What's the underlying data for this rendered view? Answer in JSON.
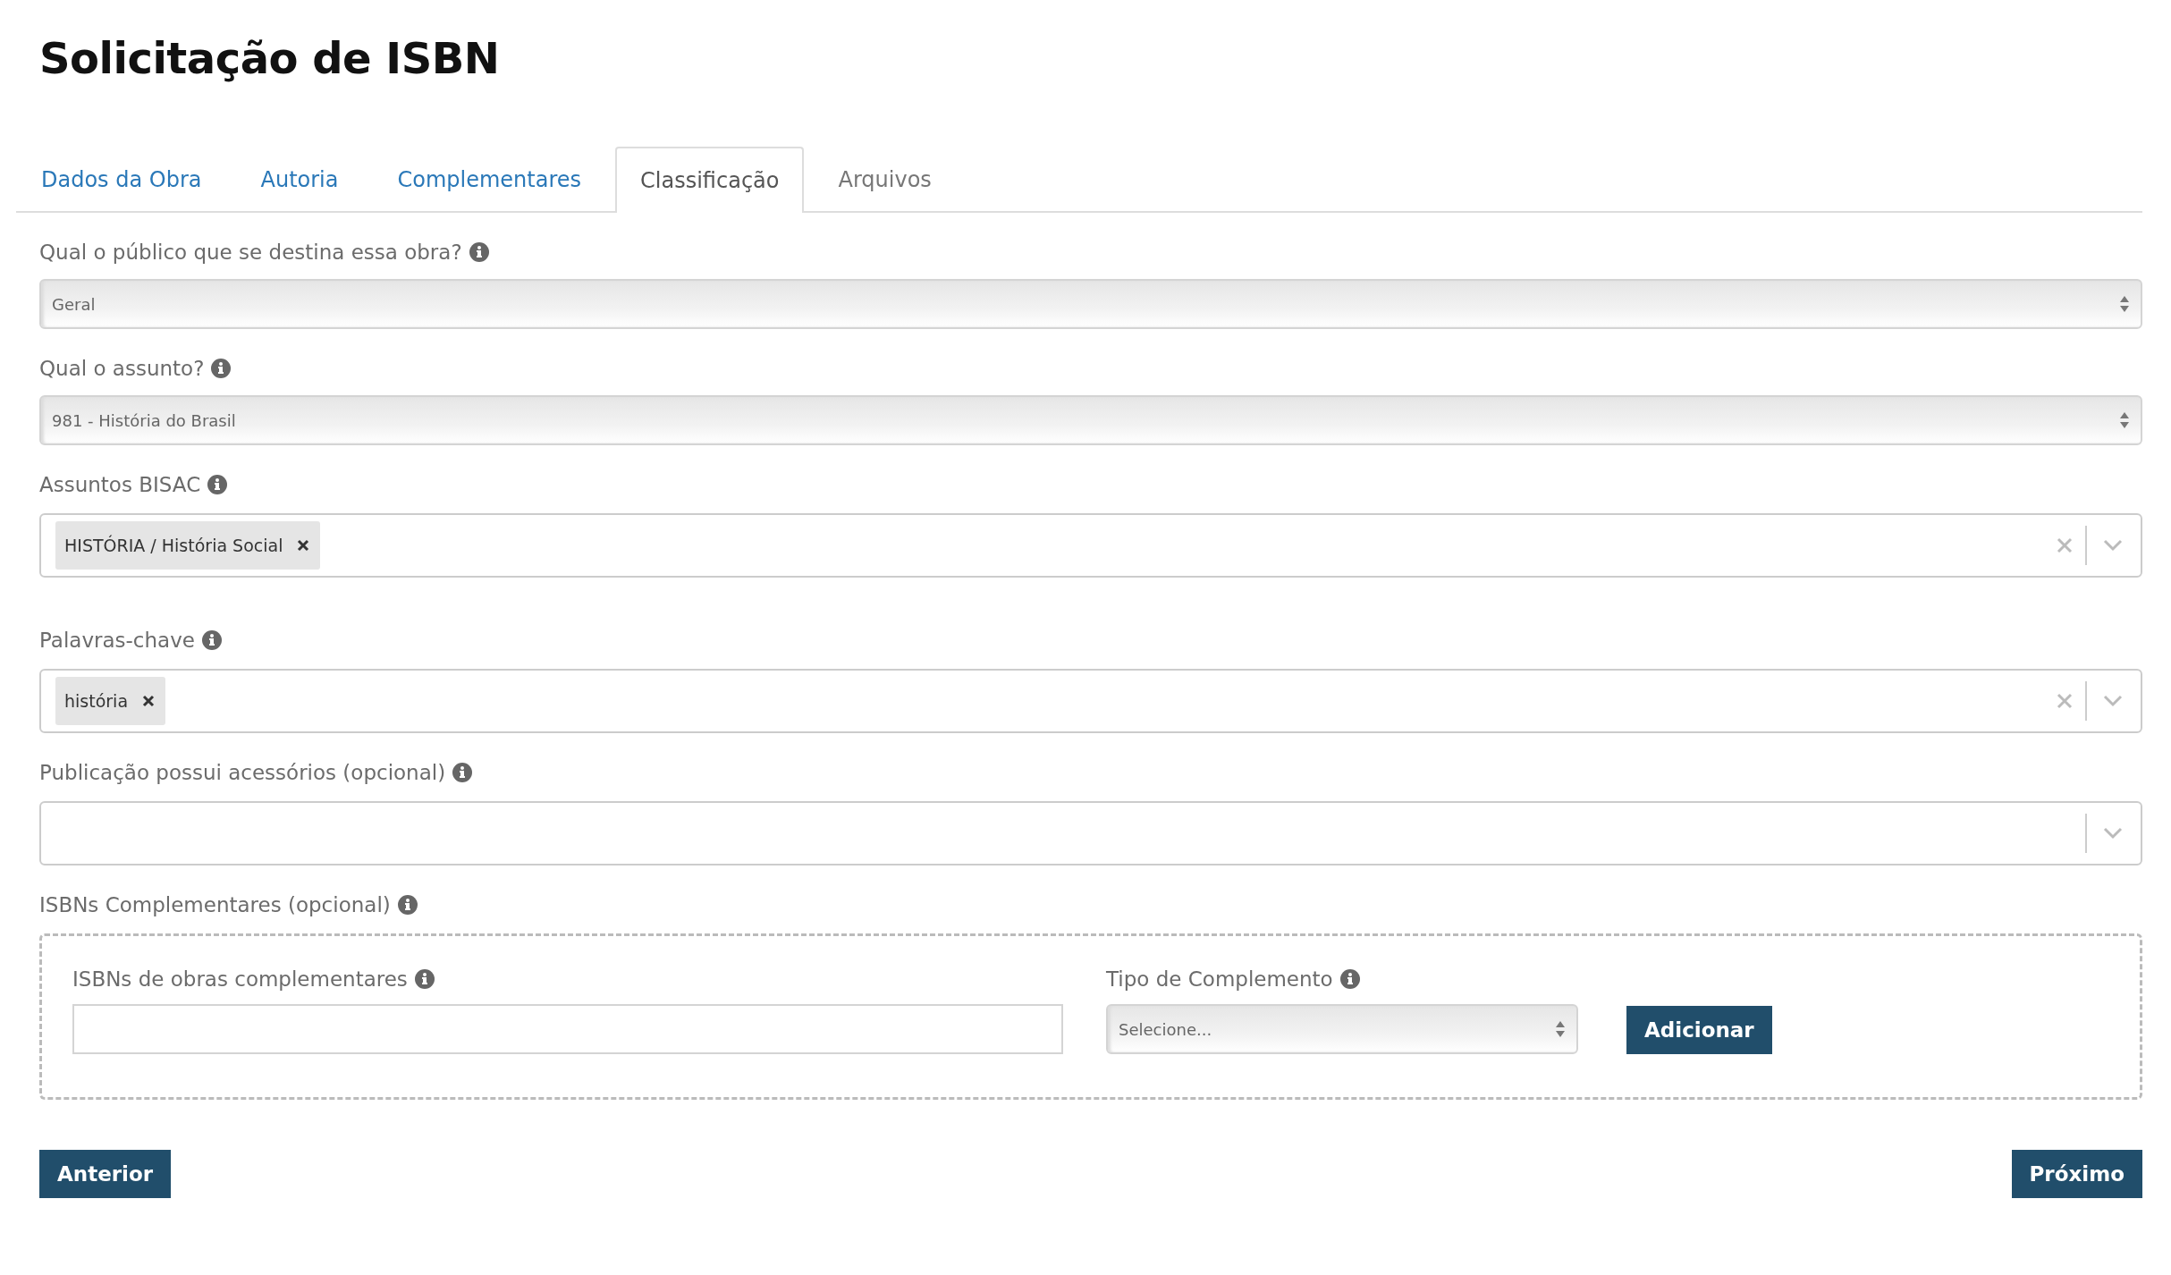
{
  "title": "Solicitação de ISBN",
  "tabs": [
    {
      "label": "Dados da Obra",
      "selected": false
    },
    {
      "label": "Autoria",
      "selected": false
    },
    {
      "label": "Complementares",
      "selected": false
    },
    {
      "label": "Classificação",
      "selected": true
    },
    {
      "label": "Arquivos",
      "selected": false
    }
  ],
  "fields": [
    {
      "kind": "select",
      "label": "Qual o público que se destina essa obra?",
      "value": "Geral"
    },
    {
      "kind": "select",
      "label": "Qual o assunto?",
      "value": "981 - História do Brasil"
    },
    {
      "kind": "multiselect",
      "label": "Assuntos BISAC",
      "tags": [
        "HISTÓRIA / História Social"
      ]
    },
    {
      "kind": "multiselect",
      "label": "Palavras-chave",
      "tags": [
        "história"
      ]
    },
    {
      "kind": "multiselect",
      "label": "Publicação possui acessórios (opcional)"
    }
  ],
  "complementary": {
    "label": "ISBNs Complementares (opcional)",
    "isbn_field": {
      "label": "ISBNs de obras complementares"
    },
    "type_field": {
      "label": "Tipo de Complemento",
      "value": "Selecione..."
    },
    "add_button": "Adicionar"
  },
  "buttons": {
    "previous": "Anterior",
    "next": "Próximo"
  }
}
